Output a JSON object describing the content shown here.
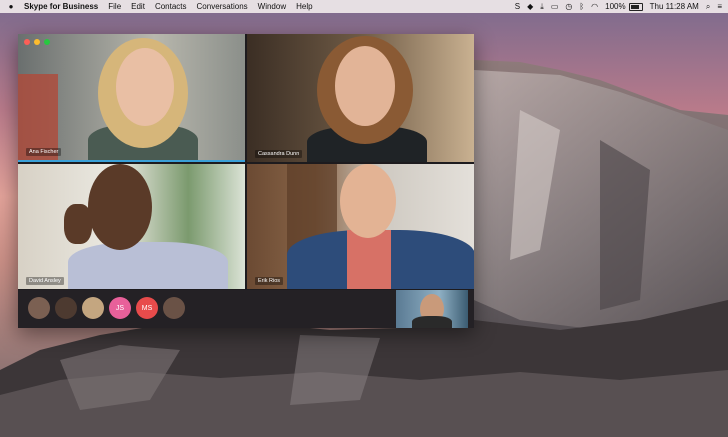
{
  "menubar": {
    "app_name": "Skype for Business",
    "menus": [
      "File",
      "Edit",
      "Contacts",
      "Conversations",
      "Window",
      "Help"
    ],
    "battery": "100%",
    "clock": "Thu 11:28 AM"
  },
  "call": {
    "participants": [
      {
        "name": "Ana Fischer"
      },
      {
        "name": "Cassandra Dunn"
      },
      {
        "name": "David Ansley"
      },
      {
        "name": "Erik Rios"
      }
    ],
    "roster": [
      {
        "initials": "",
        "icon": "participant-photo-1"
      },
      {
        "initials": "",
        "icon": "participant-photo-2"
      },
      {
        "initials": "",
        "icon": "participant-photo-3"
      },
      {
        "initials": "JS",
        "color": "#e8609a"
      },
      {
        "initials": "MS",
        "color": "#e84b4b"
      },
      {
        "initials": "",
        "icon": "participant-photo-6"
      }
    ]
  }
}
